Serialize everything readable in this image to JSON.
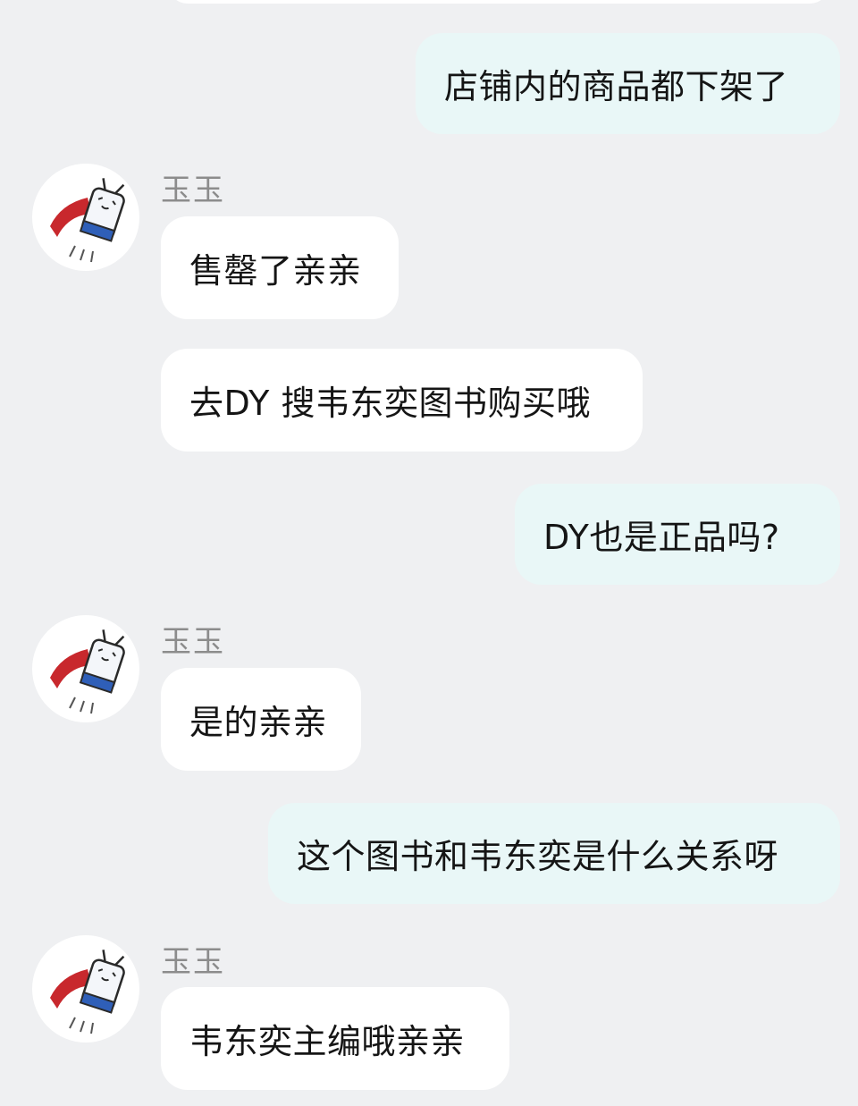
{
  "messages": [
    {
      "id": "m1",
      "role": "user",
      "text": "店铺内的商品都下架了"
    },
    {
      "id": "m2",
      "role": "bot",
      "sender": "玉玉",
      "text": "售罄了亲亲"
    },
    {
      "id": "m3",
      "role": "bot",
      "text": "去DY 搜韦东奕图书购买哦"
    },
    {
      "id": "m4",
      "role": "user",
      "text": "DY也是正品吗?"
    },
    {
      "id": "m5",
      "role": "bot",
      "sender": "玉玉",
      "text": "是的亲亲"
    },
    {
      "id": "m6",
      "role": "user",
      "text": "这个图书和韦东奕是什么关系呀"
    },
    {
      "id": "m7",
      "role": "bot",
      "sender": "玉玉",
      "text": "韦东奕主编哦亲亲"
    }
  ],
  "colors": {
    "background": "#eff0f2",
    "user_bubble": "#e9f7f7",
    "bot_bubble": "#ffffff",
    "sender_name": "#8c8c8c",
    "avatar_cape": "#c8282d",
    "avatar_shorts": "#2f5fb8"
  },
  "icons": {
    "avatar": "bilibili-tv-superhero-avatar-icon"
  }
}
